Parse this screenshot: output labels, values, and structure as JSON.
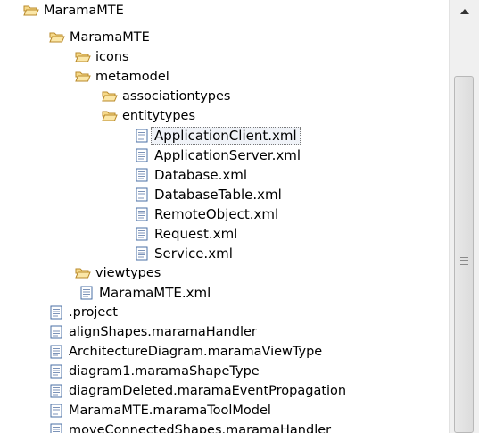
{
  "tree": {
    "items": [
      {
        "label": "MaramaMTE",
        "type": "folder"
      },
      {
        "label": "MaramaMTE",
        "type": "folder"
      },
      {
        "label": "icons",
        "type": "folder"
      },
      {
        "label": "metamodel",
        "type": "folder"
      },
      {
        "label": "associationtypes",
        "type": "folder"
      },
      {
        "label": "entitytypes",
        "type": "folder"
      },
      {
        "label": "ApplicationClient.xml",
        "type": "file",
        "selected": true
      },
      {
        "label": "ApplicationServer.xml",
        "type": "file"
      },
      {
        "label": "Database.xml",
        "type": "file"
      },
      {
        "label": "DatabaseTable.xml",
        "type": "file"
      },
      {
        "label": "RemoteObject.xml",
        "type": "file"
      },
      {
        "label": "Request.xml",
        "type": "file"
      },
      {
        "label": "Service.xml",
        "type": "file"
      },
      {
        "label": "viewtypes",
        "type": "folder"
      },
      {
        "label": "MaramaMTE.xml",
        "type": "file"
      },
      {
        "label": ".project",
        "type": "file"
      },
      {
        "label": "alignShapes.maramaHandler",
        "type": "file"
      },
      {
        "label": "ArchitectureDiagram.maramaViewType",
        "type": "file"
      },
      {
        "label": "diagram1.maramaShapeType",
        "type": "file"
      },
      {
        "label": "diagramDeleted.maramaEventPropagation",
        "type": "file"
      },
      {
        "label": "MaramaMTE.maramaToolModel",
        "type": "file"
      },
      {
        "label": "moveConnectedShapes.maramaHandler",
        "type": "file"
      }
    ]
  },
  "icons": {
    "folder": "folder-open-icon",
    "file": "file-icon",
    "scroll_up": "arrow-up-icon"
  },
  "colors": {
    "folder_fill": "#f6d98a",
    "folder_stroke": "#b98a2a",
    "file_fill": "#ffffff",
    "file_stroke": "#4a6fa5",
    "scrollbar_track": "#f0f0f0"
  }
}
